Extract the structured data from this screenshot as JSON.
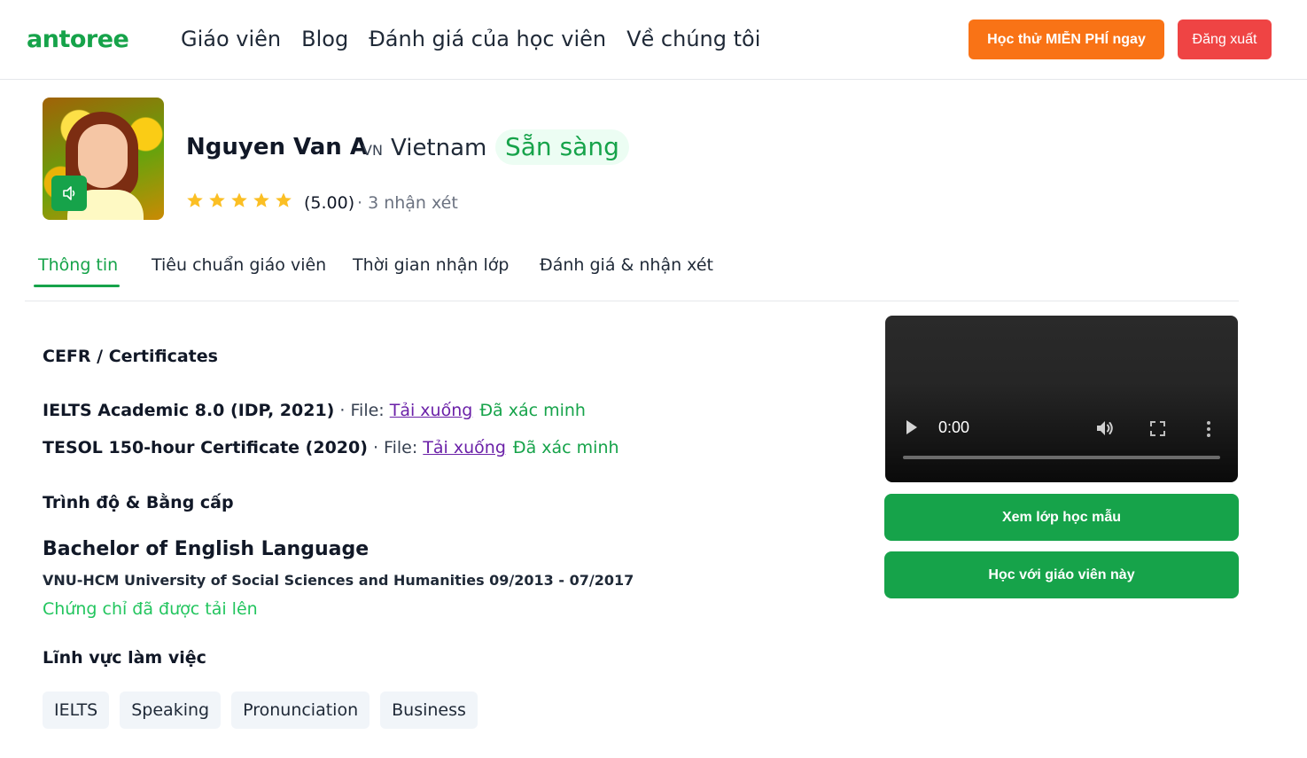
{
  "header": {
    "logo": "antoree",
    "nav": [
      "Giáo viên",
      "Blog",
      "Đánh giá của học viên",
      "Về chúng tôi"
    ],
    "trial_button": "Học thử MIỄN PHÍ ngay",
    "logout_button": "Đăng xuất",
    "colors": {
      "brand": "#16a34a",
      "trial": "#f97316",
      "logout": "#ef4444"
    }
  },
  "profile": {
    "name": "Nguyen Van A",
    "country_code": "VN",
    "country": "Vietnam",
    "status": "Sẵn sàng",
    "rating": 5.0,
    "rating_display": "(5.00)",
    "reviews": "· 3 nhận xét",
    "avatar_icon": "speaker-icon"
  },
  "tabs": [
    {
      "label": "Thông tin",
      "active": true
    },
    {
      "label": "Tiêu chuẩn giáo viên",
      "active": false
    },
    {
      "label": "Thời gian nhận lớp",
      "active": false
    },
    {
      "label": "Đánh giá & nhận xét",
      "active": false
    }
  ],
  "certificates": {
    "heading": "CEFR / Certificates",
    "items": [
      {
        "name": "IELTS Academic 8.0 (IDP, 2021)",
        "file_label": " · File: ",
        "link": "Tải xuống",
        "status": "Đã xác minh"
      },
      {
        "name": "TESOL 150-hour Certificate (2020)",
        "file_label": " · File: ",
        "link": "Tải xuống",
        "status": "Đã xác minh"
      }
    ]
  },
  "education": {
    "heading": "Trình độ & Bằng cấp",
    "degree": "Bachelor of English Language",
    "detail": "VNU-HCM University of Social Sciences and Humanities 09/2013 - 07/2017",
    "uploaded": "Chứng chỉ đã được tải lên"
  },
  "fields": {
    "heading": "Lĩnh vực làm việc",
    "chips": [
      "IELTS",
      "Speaking",
      "Pronunciation",
      "Business"
    ]
  },
  "video": {
    "time": "0:00"
  },
  "actions": {
    "sample_class": "Xem lớp học mẫu",
    "learn_with": "Học với giáo viên này"
  }
}
